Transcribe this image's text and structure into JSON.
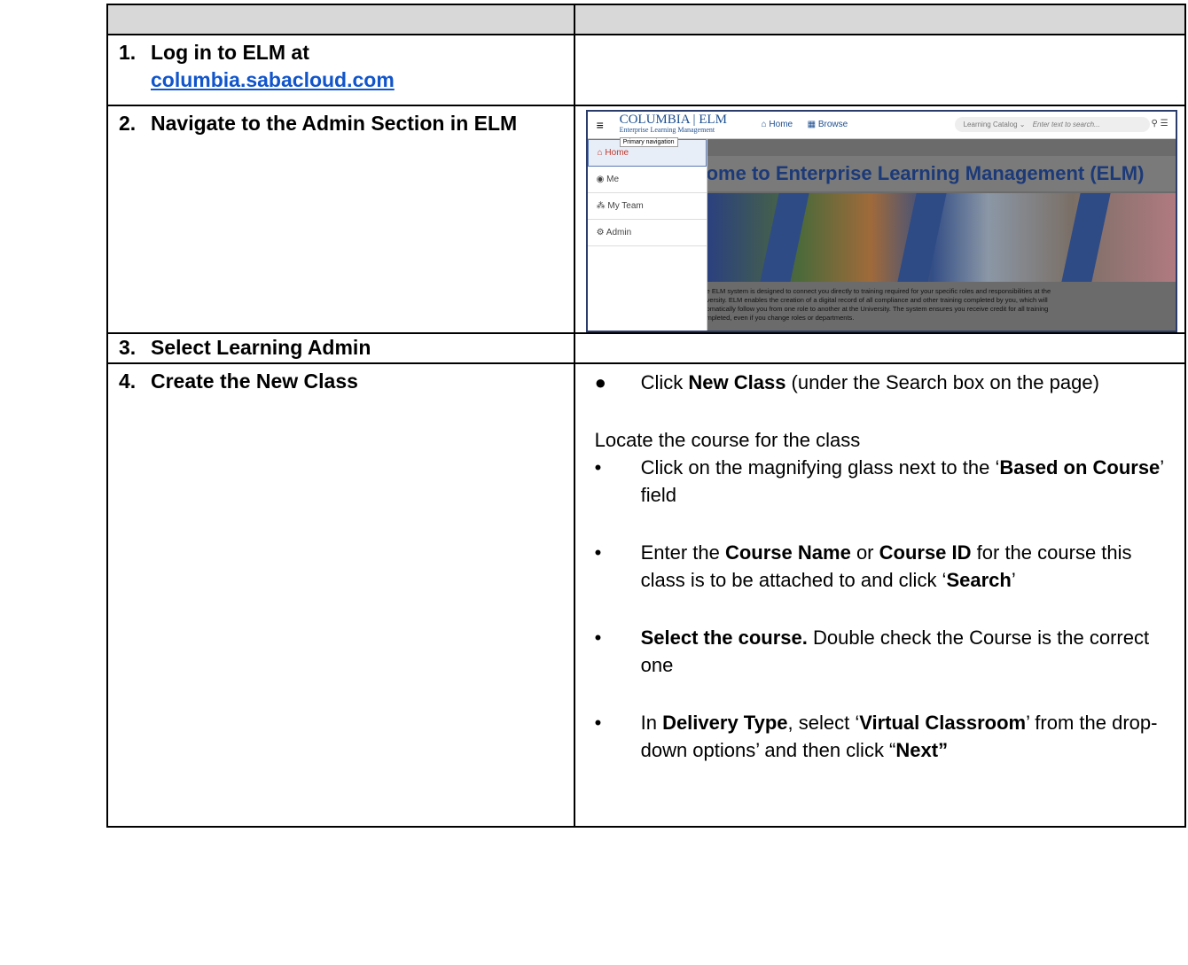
{
  "steps": [
    {
      "num": "1.",
      "text": "Log in to ELM at",
      "link": "columbia.sabacloud.com"
    },
    {
      "num": "2.",
      "text": "Navigate to the Admin Section in ELM"
    },
    {
      "num": "3.",
      "text": "Select Learning Admin"
    },
    {
      "num": "4.",
      "text": "Create the New Class"
    }
  ],
  "screenshot": {
    "logo_main": "COLUMBIA | ELM",
    "logo_sub": "Enterprise Learning Management",
    "nav_home": "Home",
    "nav_browse": "Browse",
    "search_scope": "Learning Catalog",
    "search_placeholder": "Enter text to search...",
    "tooltip": "Primary navigation",
    "menu": [
      "Home",
      "Me",
      "My Team",
      "Admin"
    ],
    "banner_title": "ome to Enterprise Learning Management (ELM)",
    "description": [
      "e ELM system is designed to connect you directly to training required for your specific roles and responsibilities at the",
      "versity. ELM enables the creation of a digital record of all compliance and other training completed by you, which will",
      "omatically follow you from one role to another at the University. The system ensures you receive credit for all training",
      "mpleted, even if you change roles or departments."
    ]
  },
  "instructions": {
    "b1_pre": "Click ",
    "b1_bold": "New Class",
    "b1_post": " (under the Search box on the page)",
    "locate": "Locate the course for the class",
    "b2_pre": "Click on the magnifying glass next to the ‘",
    "b2_bold": "Based on Course",
    "b2_post": "’ field",
    "b3_pre": "Enter the ",
    "b3_bold1": "Course Name",
    "b3_mid": " or ",
    "b3_bold2": "Course ID",
    "b3_post": " for the course this class is to be attached to and click ‘",
    "b3_bold3": "Search",
    "b3_end": "’",
    "b4_bold": "Select the course.",
    "b4_post": " Double check the Course is the correct one",
    "b5_pre": "In ",
    "b5_bold1": "Delivery Type",
    "b5_mid": ", select ‘",
    "b5_bold2": "Virtual Classroom",
    "b5_post": "’ from the drop-down options’ and then click “",
    "b5_bold3": "Next”",
    "bullet_filled": "●",
    "bullet": "•"
  }
}
